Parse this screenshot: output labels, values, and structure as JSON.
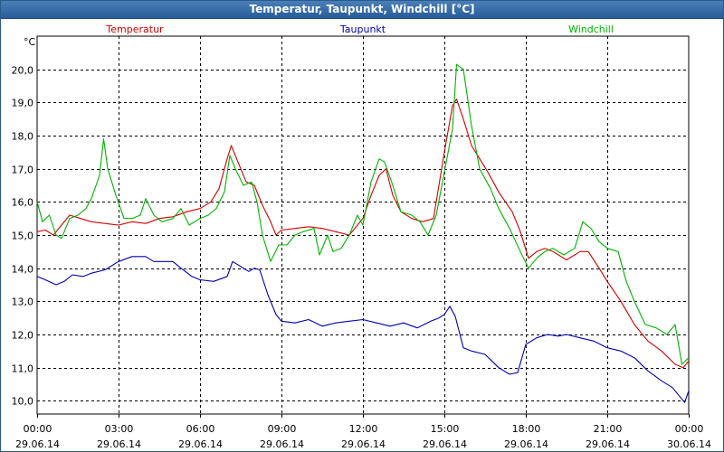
{
  "window": {
    "title": "Temperatur, Taupunkt, Windchill [°C]"
  },
  "chart_data": {
    "type": "line",
    "title": "Temperatur, Taupunkt, Windchill [°C]",
    "ylabel": "°C",
    "ylim": [
      9.6,
      21.0
    ],
    "yticks": [
      10.0,
      11.0,
      12.0,
      13.0,
      14.0,
      15.0,
      16.0,
      17.0,
      18.0,
      19.0,
      20.0
    ],
    "ytick_labels": [
      "10,0",
      "11,0",
      "12,0",
      "13,0",
      "14,0",
      "15,0",
      "16,0",
      "17,0",
      "18,0",
      "19,0",
      "20,0"
    ],
    "xlim_hours": [
      0,
      24
    ],
    "xticks_hours": [
      0,
      3,
      6,
      9,
      12,
      15,
      18,
      21,
      24
    ],
    "xtick_time_labels": [
      "00:00",
      "03:00",
      "06:00",
      "09:00",
      "12:00",
      "15:00",
      "18:00",
      "21:00",
      "00:00"
    ],
    "xtick_date_labels": [
      "29.06.14",
      "29.06.14",
      "29.06.14",
      "29.06.14",
      "29.06.14",
      "29.06.14",
      "29.06.14",
      "29.06.14",
      "30.06.14"
    ],
    "grid": true,
    "legend_placement": "top",
    "series": [
      {
        "name": "Temperatur",
        "color": "#d40000",
        "points": [
          [
            0,
            15.1
          ],
          [
            0.3,
            15.15
          ],
          [
            0.6,
            15.0
          ],
          [
            0.9,
            15.3
          ],
          [
            1.2,
            15.6
          ],
          [
            1.6,
            15.5
          ],
          [
            2.0,
            15.4
          ],
          [
            2.5,
            15.35
          ],
          [
            3.0,
            15.3
          ],
          [
            3.5,
            15.4
          ],
          [
            4.0,
            15.35
          ],
          [
            4.5,
            15.5
          ],
          [
            5.0,
            15.55
          ],
          [
            5.5,
            15.7
          ],
          [
            6.0,
            15.8
          ],
          [
            6.4,
            16.0
          ],
          [
            6.7,
            16.4
          ],
          [
            7.0,
            17.3
          ],
          [
            7.15,
            17.7
          ],
          [
            7.4,
            17.2
          ],
          [
            7.7,
            16.6
          ],
          [
            8.0,
            16.5
          ],
          [
            8.3,
            15.9
          ],
          [
            8.6,
            15.4
          ],
          [
            8.8,
            15.0
          ],
          [
            9.0,
            15.15
          ],
          [
            9.5,
            15.2
          ],
          [
            10.0,
            15.25
          ],
          [
            10.5,
            15.2
          ],
          [
            11.0,
            15.1
          ],
          [
            11.5,
            15.0
          ],
          [
            12.0,
            15.5
          ],
          [
            12.3,
            16.2
          ],
          [
            12.6,
            16.8
          ],
          [
            12.85,
            17.0
          ],
          [
            13.1,
            16.2
          ],
          [
            13.4,
            15.7
          ],
          [
            13.8,
            15.5
          ],
          [
            14.2,
            15.4
          ],
          [
            14.6,
            15.5
          ],
          [
            15.0,
            17.5
          ],
          [
            15.3,
            18.9
          ],
          [
            15.45,
            19.1
          ],
          [
            15.7,
            18.5
          ],
          [
            16.0,
            17.7
          ],
          [
            16.3,
            17.3
          ],
          [
            16.6,
            16.9
          ],
          [
            17.0,
            16.3
          ],
          [
            17.5,
            15.7
          ],
          [
            17.8,
            15.1
          ],
          [
            18.1,
            14.3
          ],
          [
            18.4,
            14.5
          ],
          [
            18.7,
            14.6
          ],
          [
            19.0,
            14.5
          ],
          [
            19.5,
            14.25
          ],
          [
            20.0,
            14.5
          ],
          [
            20.3,
            14.5
          ],
          [
            20.7,
            14.0
          ],
          [
            21.0,
            13.6
          ],
          [
            21.5,
            13.0
          ],
          [
            22.0,
            12.3
          ],
          [
            22.5,
            11.8
          ],
          [
            23.0,
            11.5
          ],
          [
            23.5,
            11.1
          ],
          [
            23.8,
            11.0
          ],
          [
            24.0,
            11.2
          ]
        ]
      },
      {
        "name": "Taupunkt",
        "color": "#0000b4",
        "points": [
          [
            0,
            13.75
          ],
          [
            0.3,
            13.65
          ],
          [
            0.7,
            13.5
          ],
          [
            1.0,
            13.6
          ],
          [
            1.3,
            13.8
          ],
          [
            1.7,
            13.75
          ],
          [
            2.0,
            13.85
          ],
          [
            2.5,
            13.95
          ],
          [
            3.0,
            14.2
          ],
          [
            3.5,
            14.35
          ],
          [
            4.0,
            14.35
          ],
          [
            4.3,
            14.2
          ],
          [
            5.0,
            14.2
          ],
          [
            5.3,
            14.0
          ],
          [
            5.7,
            13.75
          ],
          [
            6.0,
            13.65
          ],
          [
            6.5,
            13.6
          ],
          [
            7.0,
            13.75
          ],
          [
            7.2,
            14.2
          ],
          [
            7.5,
            14.05
          ],
          [
            7.8,
            13.9
          ],
          [
            8.0,
            14.0
          ],
          [
            8.2,
            13.95
          ],
          [
            8.5,
            13.2
          ],
          [
            8.8,
            12.6
          ],
          [
            9.0,
            12.4
          ],
          [
            9.5,
            12.35
          ],
          [
            10.0,
            12.45
          ],
          [
            10.5,
            12.25
          ],
          [
            11.0,
            12.35
          ],
          [
            11.5,
            12.4
          ],
          [
            12.0,
            12.45
          ],
          [
            12.5,
            12.35
          ],
          [
            13.0,
            12.25
          ],
          [
            13.5,
            12.35
          ],
          [
            14.0,
            12.2
          ],
          [
            14.5,
            12.4
          ],
          [
            14.8,
            12.5
          ],
          [
            15.0,
            12.6
          ],
          [
            15.2,
            12.85
          ],
          [
            15.4,
            12.55
          ],
          [
            15.7,
            11.6
          ],
          [
            16.0,
            11.5
          ],
          [
            16.5,
            11.4
          ],
          [
            17.0,
            11.0
          ],
          [
            17.4,
            10.8
          ],
          [
            17.7,
            10.85
          ],
          [
            18.0,
            11.7
          ],
          [
            18.4,
            11.9
          ],
          [
            18.8,
            12.0
          ],
          [
            19.2,
            11.95
          ],
          [
            19.5,
            12.0
          ],
          [
            20.0,
            11.9
          ],
          [
            20.5,
            11.8
          ],
          [
            21.0,
            11.6
          ],
          [
            21.5,
            11.5
          ],
          [
            22.0,
            11.3
          ],
          [
            22.5,
            10.9
          ],
          [
            23.0,
            10.6
          ],
          [
            23.4,
            10.4
          ],
          [
            23.7,
            10.1
          ],
          [
            23.85,
            9.95
          ],
          [
            24.0,
            10.3
          ]
        ]
      },
      {
        "name": "Windchill",
        "color": "#00b400",
        "points": [
          [
            0,
            16.0
          ],
          [
            0.2,
            15.4
          ],
          [
            0.45,
            15.6
          ],
          [
            0.7,
            15.0
          ],
          [
            0.9,
            14.9
          ],
          [
            1.2,
            15.5
          ],
          [
            1.5,
            15.6
          ],
          [
            1.8,
            15.8
          ],
          [
            2.0,
            16.1
          ],
          [
            2.3,
            16.8
          ],
          [
            2.45,
            17.9
          ],
          [
            2.6,
            17.0
          ],
          [
            2.9,
            16.2
          ],
          [
            3.2,
            15.5
          ],
          [
            3.5,
            15.5
          ],
          [
            3.8,
            15.6
          ],
          [
            4.0,
            16.1
          ],
          [
            4.3,
            15.6
          ],
          [
            4.6,
            15.4
          ],
          [
            5.0,
            15.5
          ],
          [
            5.3,
            15.8
          ],
          [
            5.6,
            15.3
          ],
          [
            6.0,
            15.5
          ],
          [
            6.3,
            15.6
          ],
          [
            6.6,
            15.8
          ],
          [
            6.9,
            16.3
          ],
          [
            7.1,
            17.4
          ],
          [
            7.3,
            17.0
          ],
          [
            7.6,
            16.5
          ],
          [
            7.9,
            16.6
          ],
          [
            8.1,
            16.0
          ],
          [
            8.3,
            15.0
          ],
          [
            8.6,
            14.2
          ],
          [
            8.9,
            14.7
          ],
          [
            9.2,
            14.7
          ],
          [
            9.5,
            15.0
          ],
          [
            9.8,
            15.1
          ],
          [
            10.2,
            15.2
          ],
          [
            10.4,
            14.4
          ],
          [
            10.7,
            15.0
          ],
          [
            10.9,
            14.5
          ],
          [
            11.2,
            14.6
          ],
          [
            11.5,
            15.0
          ],
          [
            11.8,
            15.6
          ],
          [
            12.0,
            15.3
          ],
          [
            12.3,
            16.6
          ],
          [
            12.6,
            17.3
          ],
          [
            12.8,
            17.2
          ],
          [
            13.1,
            16.5
          ],
          [
            13.4,
            15.7
          ],
          [
            13.8,
            15.6
          ],
          [
            14.1,
            15.4
          ],
          [
            14.4,
            15.0
          ],
          [
            14.7,
            15.6
          ],
          [
            15.0,
            16.9
          ],
          [
            15.3,
            18.2
          ],
          [
            15.45,
            20.15
          ],
          [
            15.7,
            20.0
          ],
          [
            16.0,
            18.3
          ],
          [
            16.3,
            17.0
          ],
          [
            16.7,
            16.4
          ],
          [
            17.0,
            15.8
          ],
          [
            17.4,
            15.2
          ],
          [
            17.8,
            14.5
          ],
          [
            18.1,
            14.0
          ],
          [
            18.4,
            14.3
          ],
          [
            18.7,
            14.5
          ],
          [
            19.0,
            14.6
          ],
          [
            19.4,
            14.4
          ],
          [
            19.8,
            14.6
          ],
          [
            20.1,
            15.4
          ],
          [
            20.4,
            15.2
          ],
          [
            20.7,
            14.8
          ],
          [
            21.0,
            14.6
          ],
          [
            21.4,
            14.5
          ],
          [
            21.7,
            13.6
          ],
          [
            22.0,
            13.0
          ],
          [
            22.4,
            12.3
          ],
          [
            22.8,
            12.2
          ],
          [
            23.2,
            12.0
          ],
          [
            23.5,
            12.3
          ],
          [
            23.75,
            11.1
          ],
          [
            24.0,
            11.3
          ]
        ]
      }
    ]
  }
}
